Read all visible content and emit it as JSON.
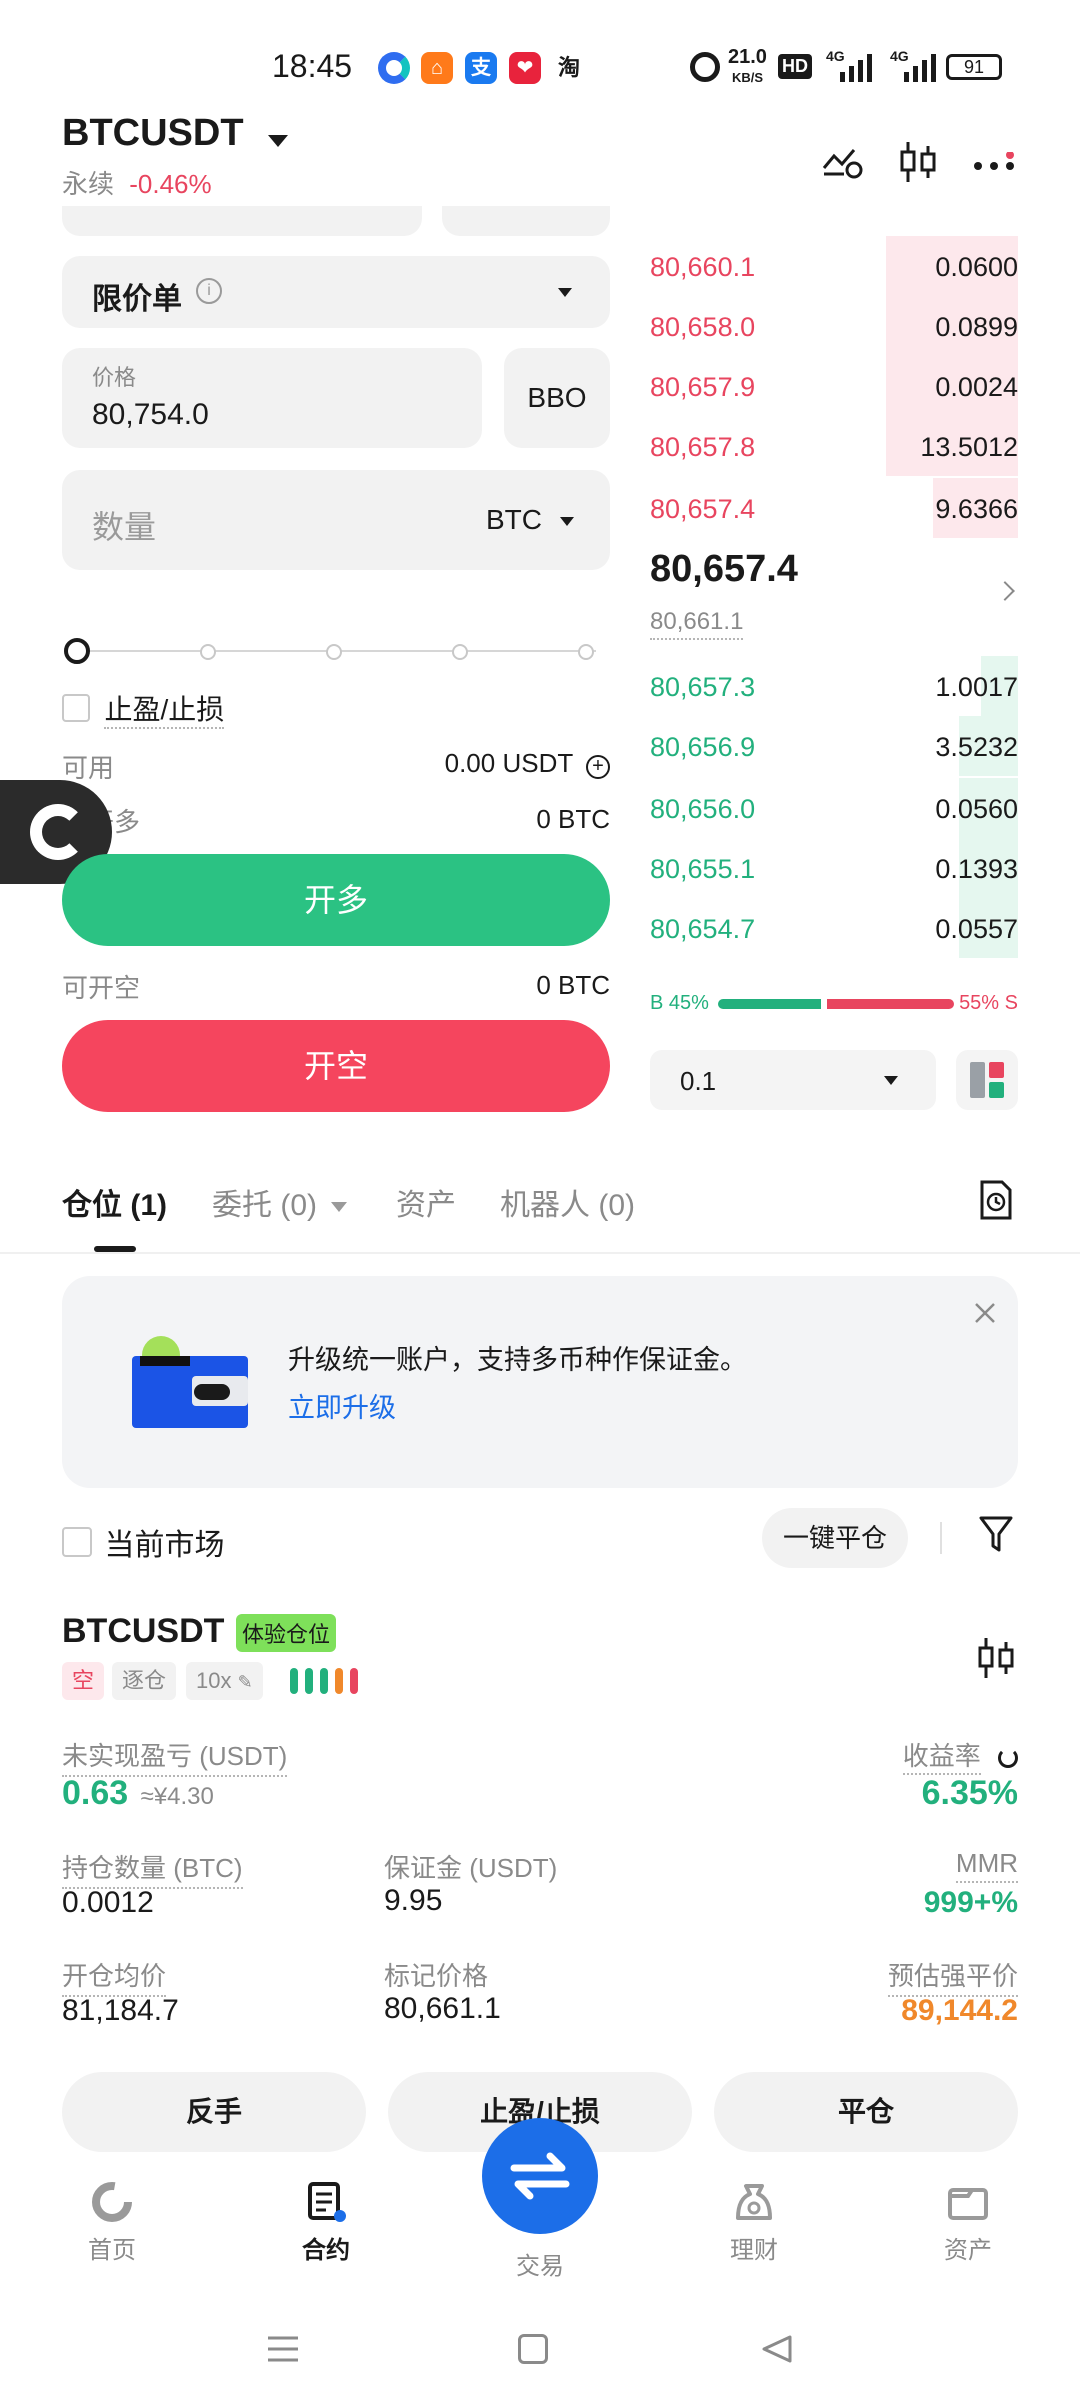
{
  "status_bar": {
    "time": "18:45",
    "net_speed": "21.0",
    "net_unit": "KB/S",
    "hd": "HD",
    "sig1": "4G",
    "sig2": "4G",
    "battery": "91",
    "app_labels": [
      "支",
      "淘"
    ]
  },
  "header": {
    "symbol": "BTCUSDT",
    "contract_type": "永续",
    "change": "-0.46%"
  },
  "order_form": {
    "order_type": "限价单",
    "price_label": "价格",
    "price_value": "80,754.0",
    "bbo_label": "BBO",
    "qty_placeholder": "数量",
    "qty_unit": "BTC",
    "tp_sl_label": "止盈/止损",
    "available_label": "可用",
    "available_value": "0.00 USDT",
    "can_open_long_label": "可开多",
    "can_open_long_value": "0 BTC",
    "open_long_button": "开多",
    "can_open_short_label": "可开空",
    "can_open_short_value": "0 BTC",
    "open_short_button": "开空",
    "slider_percent": 0
  },
  "order_book": {
    "asks": [
      {
        "price": "80,660.1",
        "qty": "0.0600",
        "depth": 0.36
      },
      {
        "price": "80,658.0",
        "qty": "0.0899",
        "depth": 0.36
      },
      {
        "price": "80,657.9",
        "qty": "0.0024",
        "depth": 0.36
      },
      {
        "price": "80,657.8",
        "qty": "13.5012",
        "depth": 0.36
      },
      {
        "price": "80,657.4",
        "qty": "9.6366",
        "depth": 0.23
      }
    ],
    "last_price": "80,657.4",
    "mark_price": "80,661.1",
    "bids": [
      {
        "price": "80,657.3",
        "qty": "1.0017",
        "depth": 0.1
      },
      {
        "price": "80,656.9",
        "qty": "3.5232",
        "depth": 0.16
      },
      {
        "price": "80,656.0",
        "qty": "0.0560",
        "depth": 0.16
      },
      {
        "price": "80,655.1",
        "qty": "0.1393",
        "depth": 0.16
      },
      {
        "price": "80,654.7",
        "qty": "0.0557",
        "depth": 0.16
      }
    ],
    "buy_ratio_label": "B 45%",
    "sell_ratio_label": "55% S",
    "buy_ratio": 0.45,
    "precision": "0.1"
  },
  "tabs": [
    {
      "label": "仓位 (1)"
    },
    {
      "label": "委托 (0)"
    },
    {
      "label": "资产"
    },
    {
      "label": "机器人 (0)"
    }
  ],
  "banner": {
    "text": "升级统一账户，支持多币种作保证金。",
    "link": "立即升级"
  },
  "filter": {
    "current_market_label": "当前市场",
    "close_all_button": "一键平仓"
  },
  "position": {
    "symbol": "BTCUSDT",
    "badge": "体验仓位",
    "side_tag": "空",
    "margin_tag": "逐仓",
    "leverage_tag": "10x",
    "pnl_label": "未实现盈亏 (USDT)",
    "pnl_value": "0.63",
    "pnl_cny": "≈¥4.30",
    "roe_label": "收益率",
    "roe_value": "6.35%",
    "size_label": "持仓数量 (BTC)",
    "size_value": "0.0012",
    "margin_label": "保证金 (USDT)",
    "margin_value": "9.95",
    "mmr_label": "MMR",
    "mmr_value": "999+%",
    "entry_label": "开仓均价",
    "entry_value": "81,184.7",
    "mark_label": "标记价格",
    "mark_value": "80,661.1",
    "liq_label": "预估强平价",
    "liq_value": "89,144.2",
    "reverse_button": "反手",
    "tpsl_button": "止盈/止损",
    "close_button": "平仓"
  },
  "bottom_nav": [
    {
      "label": "首页"
    },
    {
      "label": "合约"
    },
    {
      "label": "交易"
    },
    {
      "label": "理财"
    },
    {
      "label": "资产"
    }
  ],
  "colors": {
    "green": "#22b07d",
    "red": "#e8455f",
    "orange": "#f0882b",
    "blue": "#1c6ee8",
    "badge_green": "#7ee05a"
  }
}
